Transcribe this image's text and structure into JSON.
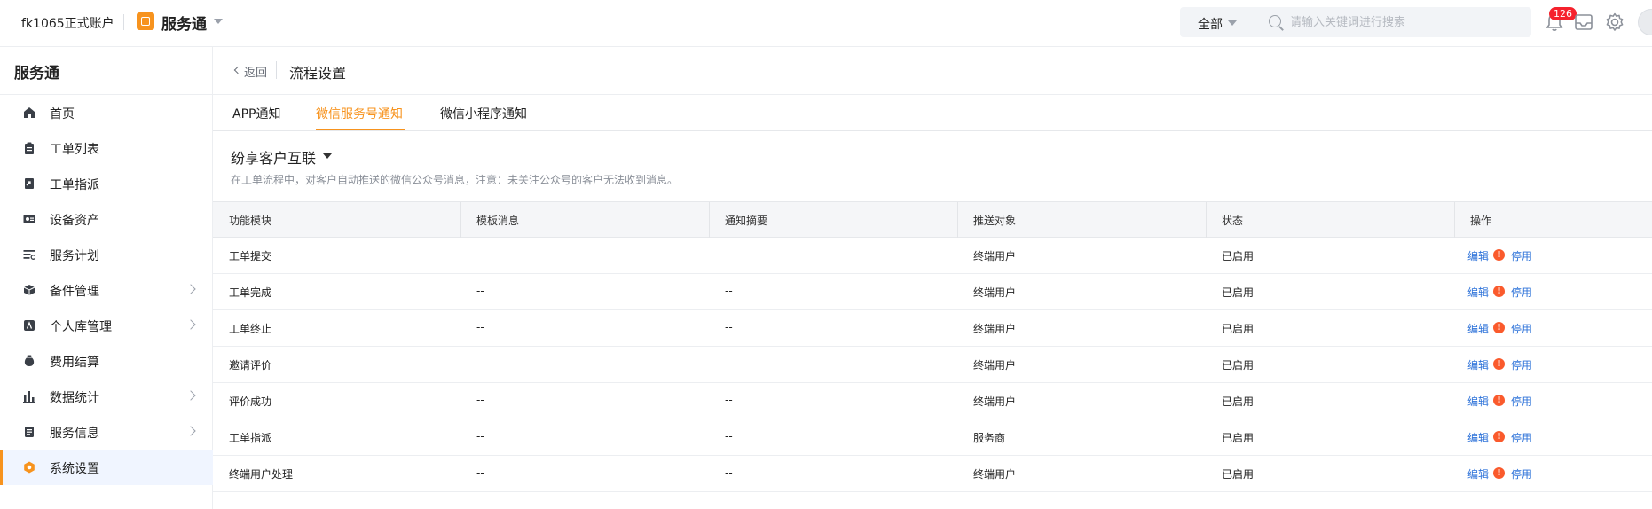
{
  "topbar": {
    "account": "fk1065正式账户",
    "app_name": "服务通",
    "search_scope": "全部",
    "search_placeholder": "请输入关键词进行搜索",
    "notification_count": "126"
  },
  "sidebar": {
    "title": "服务通",
    "items": [
      {
        "label": "首页",
        "has_children": false
      },
      {
        "label": "工单列表",
        "has_children": false
      },
      {
        "label": "工单指派",
        "has_children": false
      },
      {
        "label": "设备资产",
        "has_children": false
      },
      {
        "label": "服务计划",
        "has_children": false
      },
      {
        "label": "备件管理",
        "has_children": true
      },
      {
        "label": "个人库管理",
        "has_children": true
      },
      {
        "label": "费用结算",
        "has_children": false
      },
      {
        "label": "数据统计",
        "has_children": true
      },
      {
        "label": "服务信息",
        "has_children": true
      },
      {
        "label": "系统设置",
        "has_children": false,
        "active": true
      }
    ]
  },
  "header": {
    "back_label": "返回",
    "page_title": "流程设置"
  },
  "tabs": [
    {
      "label": "APP通知"
    },
    {
      "label": "微信服务号通知",
      "active": true
    },
    {
      "label": "微信小程序通知"
    }
  ],
  "section": {
    "title": "纷享客户互联",
    "description": "在工单流程中，对客户自动推送的微信公众号消息，注意：未关注公众号的客户无法收到消息。"
  },
  "table": {
    "columns": [
      "功能模块",
      "模板消息",
      "通知摘要",
      "推送对象",
      "状态",
      "操作"
    ],
    "rows": [
      {
        "module": "工单提交",
        "template": "--",
        "summary": "--",
        "target": "终端用户",
        "status": "已启用"
      },
      {
        "module": "工单完成",
        "template": "--",
        "summary": "--",
        "target": "终端用户",
        "status": "已启用"
      },
      {
        "module": "工单终止",
        "template": "--",
        "summary": "--",
        "target": "终端用户",
        "status": "已启用"
      },
      {
        "module": "邀请评价",
        "template": "--",
        "summary": "--",
        "target": "终端用户",
        "status": "已启用"
      },
      {
        "module": "评价成功",
        "template": "--",
        "summary": "--",
        "target": "终端用户",
        "status": "已启用"
      },
      {
        "module": "工单指派",
        "template": "--",
        "summary": "--",
        "target": "服务商",
        "status": "已启用"
      },
      {
        "module": "终端用户处理",
        "template": "--",
        "summary": "--",
        "target": "终端用户",
        "status": "已启用"
      }
    ],
    "edit_label": "编辑",
    "warn_mark": "!",
    "disable_label": "停用"
  },
  "colors": {
    "accent": "#f7931e",
    "link": "#2d72d9",
    "warn": "#fa5a2c",
    "badge": "#f5222d"
  },
  "icons": {
    "sidebar": [
      "home-icon",
      "clipboard-icon",
      "dispatch-icon",
      "device-card-icon",
      "plan-list-icon",
      "box-icon",
      "user-storage-icon",
      "money-bag-icon",
      "bar-chart-icon",
      "info-doc-icon",
      "settings-hex-icon"
    ]
  }
}
